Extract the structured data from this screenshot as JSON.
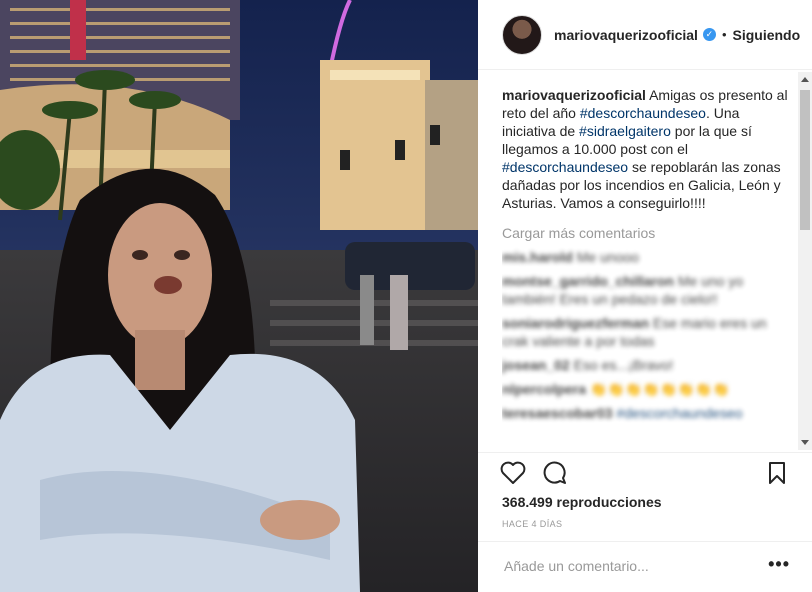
{
  "post": {
    "username": "mariovaquerizooficial",
    "separator": "•",
    "follow_label": "Siguiendo",
    "caption_user": "mariovaquerizooficial",
    "caption_parts": {
      "p1": "Amigas os presento al reto del año ",
      "tag1": "#descorchaundeseo",
      "p2": ". Una iniciativa de ",
      "tag2": "#sidraelgaitero",
      "p3": " por la que sí llegamos a 10.000 post con el ",
      "tag3": "#descorchaundeseo",
      "p4": " se repoblarán las zonas dañadas por los incendios en Galicia, León y Asturias. Vamos a conseguirlo!!!!"
    },
    "load_more_label": "Cargar más comentarios",
    "comments": [
      {
        "user": "mis.harold",
        "text": "Me unooo"
      },
      {
        "user": "montse_garrido_chillaron",
        "text": "Me uno yo también! Eres un pedazo de cielo!!"
      },
      {
        "user": "soniarodriguezferman",
        "text": "Ese mario eres un crak valiente a por todas"
      },
      {
        "user": "josean_02",
        "text": "Eso es...¡Bravo!"
      },
      {
        "user": "nlpercolpera",
        "text": "👏👏👏👏👏👏👏👏"
      },
      {
        "user": "teresaescobar03",
        "text": "#descorchaundeseo"
      }
    ],
    "views": "368.499 reproducciones",
    "date": "HACE 4 DÍAS",
    "add_comment_placeholder": "Añade un comentario...",
    "more_label": "•••"
  },
  "icons": {
    "like": "heart-icon",
    "comment": "comment-bubble-icon",
    "save": "bookmark-icon",
    "verified": "verified-badge-icon"
  },
  "colors": {
    "hashtag": "#003569",
    "verified": "#3897f0",
    "muted": "#999999",
    "text": "#262626"
  }
}
